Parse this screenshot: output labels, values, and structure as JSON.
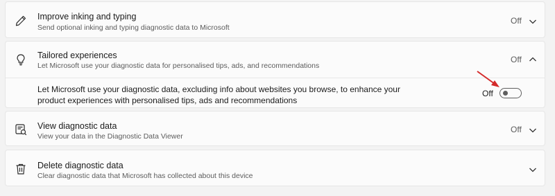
{
  "settings": {
    "inking": {
      "title": "Improve inking and typing",
      "description": "Send optional inking and typing diagnostic data to Microsoft",
      "state": "Off",
      "icon": "pen-icon"
    },
    "tailored": {
      "title": "Tailored experiences",
      "description": "Let Microsoft use your diagnostic data for personalised tips, ads, and recommendations",
      "state": "Off",
      "icon": "lightbulb-icon",
      "expanded": true,
      "sub_setting": {
        "text": "Let Microsoft use your diagnostic data, excluding info about websites you browse, to enhance your product experiences with personalised tips, ads and recommendations",
        "toggle_label": "Off",
        "toggle_on": false
      }
    },
    "view": {
      "title": "View diagnostic data",
      "description": "View your data in the Diagnostic Data Viewer",
      "state": "Off",
      "icon": "data-viewer-icon"
    },
    "delete": {
      "title": "Delete diagnostic data",
      "description": "Clear diagnostic data that Microsoft has collected about this device",
      "icon": "trash-icon"
    }
  },
  "annotation": {
    "arrow_color": "#d42a2a"
  },
  "colors": {
    "background": "#f3f3f3",
    "card": "#fbfbfb"
  }
}
